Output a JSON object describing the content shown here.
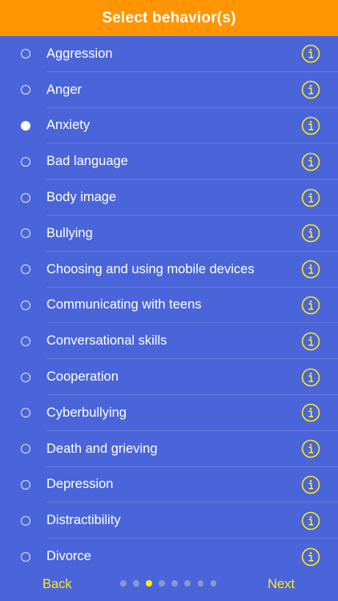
{
  "header": {
    "title": "Select behavior(s)"
  },
  "behaviors": [
    {
      "label": "Aggression",
      "selected": false
    },
    {
      "label": "Anger",
      "selected": false
    },
    {
      "label": "Anxiety",
      "selected": true
    },
    {
      "label": "Bad language",
      "selected": false
    },
    {
      "label": "Body image",
      "selected": false
    },
    {
      "label": "Bullying",
      "selected": false
    },
    {
      "label": "Choosing and using mobile devices",
      "selected": false
    },
    {
      "label": "Communicating with teens",
      "selected": false
    },
    {
      "label": "Conversational skills",
      "selected": false
    },
    {
      "label": "Cooperation",
      "selected": false
    },
    {
      "label": "Cyberbullying",
      "selected": false
    },
    {
      "label": "Death and grieving",
      "selected": false
    },
    {
      "label": "Depression",
      "selected": false
    },
    {
      "label": "Distractibility",
      "selected": false
    },
    {
      "label": "Divorce",
      "selected": false
    }
  ],
  "footer": {
    "back_label": "Back",
    "next_label": "Next",
    "page_count": 8,
    "current_page": 3
  },
  "colors": {
    "background": "#4A65D9",
    "header": "#FF9500",
    "accent": "#FFE81A"
  },
  "icons": {
    "info": "info-circle-icon",
    "radio": "radio-circle-icon"
  }
}
